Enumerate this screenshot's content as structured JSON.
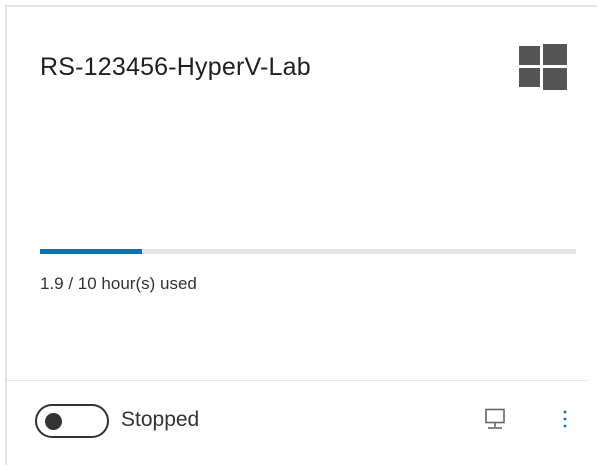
{
  "card": {
    "title": "RS-123456-HyperV-Lab",
    "os_icon": "windows-logo-icon",
    "usage": {
      "used": 1.9,
      "quota": 10,
      "text": "1.9 / 10 hour(s) used",
      "fraction": 0.19
    },
    "status": "Stopped",
    "toggle_on": false,
    "icons": {
      "connect": "monitor-connect-icon",
      "more": "more-options-icon"
    },
    "colors": {
      "progress_fill": "#106ebe",
      "progress_track": "#e6e6e6",
      "os_icon": "#555555"
    }
  }
}
